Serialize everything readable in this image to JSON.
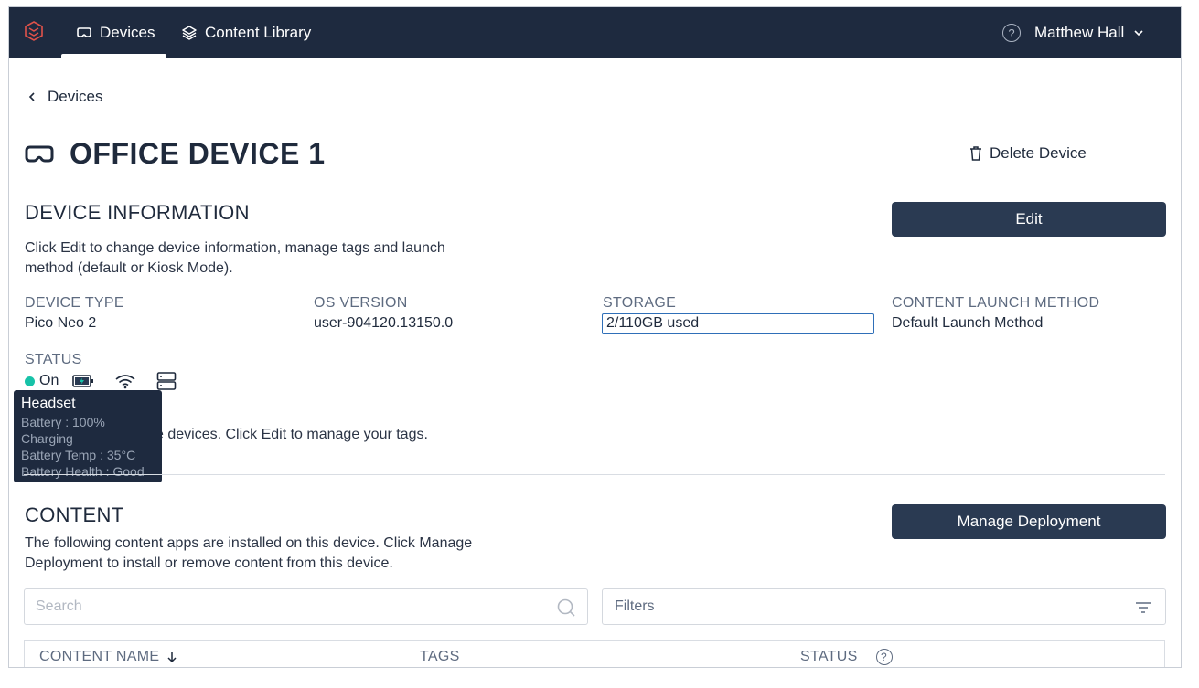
{
  "nav": {
    "devices_label": "Devices",
    "content_library_label": "Content Library",
    "user_name": "Matthew Hall",
    "help_glyph": "?"
  },
  "breadcrumb": {
    "label": "Devices"
  },
  "device": {
    "title": "OFFICE DEVICE 1",
    "delete_label": "Delete Device"
  },
  "info": {
    "heading": "DEVICE INFORMATION",
    "edit_label": "Edit",
    "desc_line1": "Click Edit to change device information, manage tags and launch",
    "desc_line2": "method (default or Kiosk Mode).",
    "device_type_label": "DEVICE TYPE",
    "device_type_value": "Pico Neo 2",
    "os_label": "OS VERSION",
    "os_value": "user-904120.13150.0",
    "storage_label": "STORAGE",
    "storage_value": "2/110GB used",
    "launch_label": "CONTENT LAUNCH METHOD",
    "launch_value": "Default Launch Method",
    "status_label": "STATUS",
    "status_value": "On",
    "tags_desc_visible": "e devices. Click Edit to manage your tags."
  },
  "tooltip": {
    "title": "Headset",
    "battery": "Battery : 100%",
    "charging": "Charging",
    "temp": "Battery Temp : 35°C",
    "health": "Battery Health : Good"
  },
  "content": {
    "heading": "CONTENT",
    "manage_label": "Manage Deployment",
    "desc_line1": "The following content apps are installed on this device. Click Manage",
    "desc_line2": "Deployment to install or remove content from this device.",
    "search_placeholder": "Search",
    "filters_label": "Filters",
    "columns": [
      "CONTENT NAME",
      "TAGS",
      "STATUS"
    ]
  },
  "colors": {
    "nav_bg": "#1e2a3f",
    "primary_button": "#2a3a52",
    "status_on": "#17c2a8",
    "logo_accent": "#e0524a"
  }
}
